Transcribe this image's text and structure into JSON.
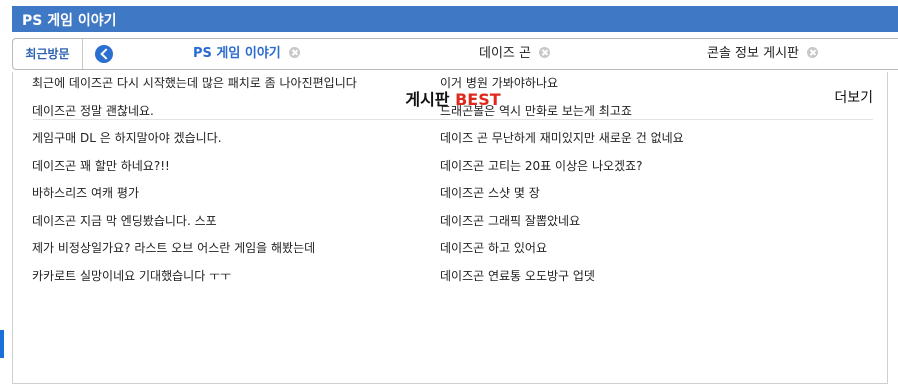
{
  "title": "PS 게임 이야기",
  "tabs": {
    "recent_label": "최근방문",
    "items": [
      {
        "label": "PS 게임 이야기",
        "active": true
      },
      {
        "label": "데이즈 곤",
        "active": false
      },
      {
        "label": "콘솔 정보 게시판",
        "active": false
      }
    ]
  },
  "board": {
    "title_prefix": "게시판",
    "title_highlight": "BEST",
    "more_label": "더보기",
    "highlight_color": "#e0281c",
    "left_column": [
      "최근에 데이즈곤 다시 시작했는데 많은 패치로 좀 나아진편입니다",
      "데이즈곤 정말 괜찮네요.",
      "게임구매 DL 은 하지말아야 겠습니다.",
      "데이즈곤 꽤 할만 하네요?!!",
      "바하스리즈 여캐 평가",
      "데이즈곤 지금 막 엔딩봤습니다. 스포",
      "제가 비정상일가요? 라스트 오브 어스란 게임을 해봤는데",
      "카카로트 실망이네요 기대했습니다 ㅜㅜ"
    ],
    "right_column": [
      "이거 병원 가봐야하나요",
      "드래곤볼은 역시 만화로 보는게 최고죠",
      "데이즈 곤 무난하게 재미있지만 새로운 건 없네요",
      "데이즈곤 고티는 20표 이상은 나오겠죠?",
      "데이즈곤 스샷 몇 장",
      "데이즈곤 그래픽 잘뽑았네요",
      "데이즈곤 하고 있어요",
      "데이즈곤 연료통 오도방구 업뎃"
    ]
  },
  "icons": {
    "back": "chevron-left-circle-icon",
    "close": "close-circle-icon"
  },
  "colors": {
    "header_bg": "#3f78c4",
    "active_tab": "#2a6bd0",
    "accent": "#2b6fd1"
  }
}
